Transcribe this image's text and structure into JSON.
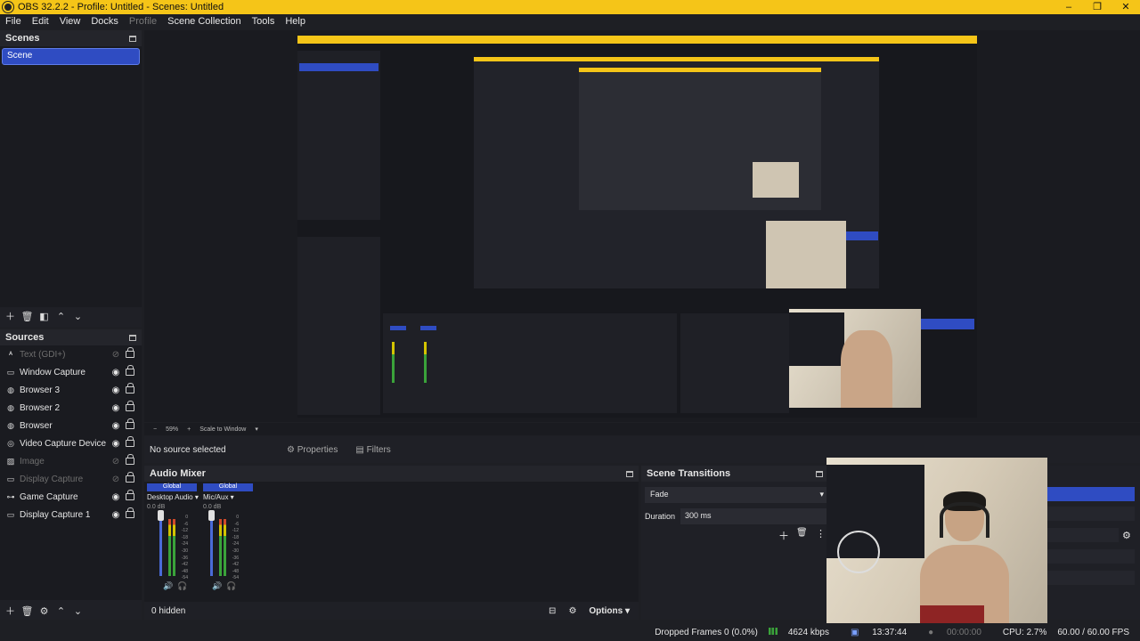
{
  "window": {
    "title": "OBS 32.2.2 - Profile: Untitled - Scenes: Untitled",
    "controls": [
      "–",
      "❐",
      "✕"
    ]
  },
  "menu": [
    "File",
    "Edit",
    "View",
    "Docks",
    "Profile",
    "Scene Collection",
    "Tools",
    "Help"
  ],
  "scenes": {
    "title": "Scenes",
    "items": [
      "Scene"
    ]
  },
  "sources": {
    "title": "Sources",
    "items": [
      {
        "label": "Text (GDI+)",
        "icon": "text-icon",
        "visible": false
      },
      {
        "label": "Window Capture",
        "icon": "window-icon",
        "visible": true
      },
      {
        "label": "Browser 3",
        "icon": "globe-icon",
        "visible": true
      },
      {
        "label": "Browser 2",
        "icon": "globe-icon",
        "visible": true
      },
      {
        "label": "Browser",
        "icon": "globe-icon",
        "visible": true
      },
      {
        "label": "Video Capture Device",
        "icon": "camera-icon",
        "visible": true
      },
      {
        "label": "Image",
        "icon": "image-icon",
        "visible": false
      },
      {
        "label": "Display Capture",
        "icon": "monitor-icon",
        "visible": false
      },
      {
        "label": "Game Capture",
        "icon": "gamepad-icon",
        "visible": true
      },
      {
        "label": "Display Capture 1",
        "icon": "monitor-icon",
        "visible": true
      }
    ]
  },
  "zoombar": {
    "minus": "−",
    "zoom": "59%",
    "plus": "+",
    "mode": "Scale to Window"
  },
  "context": {
    "no_selection": "No source selected",
    "properties": "Properties",
    "filters": "Filters"
  },
  "mixer": {
    "title": "Audio Mixer",
    "channels": [
      {
        "global": "Global",
        "name": "Desktop Audio",
        "db": "0.0 dB"
      },
      {
        "global": "Global",
        "name": "Mic/Aux",
        "db": "0.0 dB"
      }
    ],
    "scale": [
      "0",
      "-6",
      "-12",
      "-18",
      "-24",
      "-30",
      "-36",
      "-42",
      "-48",
      "-54",
      "-60"
    ],
    "hidden": "0 hidden",
    "options": "Options"
  },
  "transitions": {
    "title": "Scene Transitions",
    "selected": "Fade",
    "duration_label": "Duration",
    "duration_value": "300 ms"
  },
  "status": {
    "dropped": "Dropped Frames 0 (0.0%)",
    "kbps": "4624 kbps",
    "rec_time": "13:37:44",
    "stream_time": "00:00:00",
    "cpu": "CPU: 2.7%",
    "fps": "60.00 / 60.00 FPS"
  },
  "colors": {
    "titlebar": "#f5c518",
    "accent": "#2f4cc2",
    "bg": "#1e1f24"
  }
}
